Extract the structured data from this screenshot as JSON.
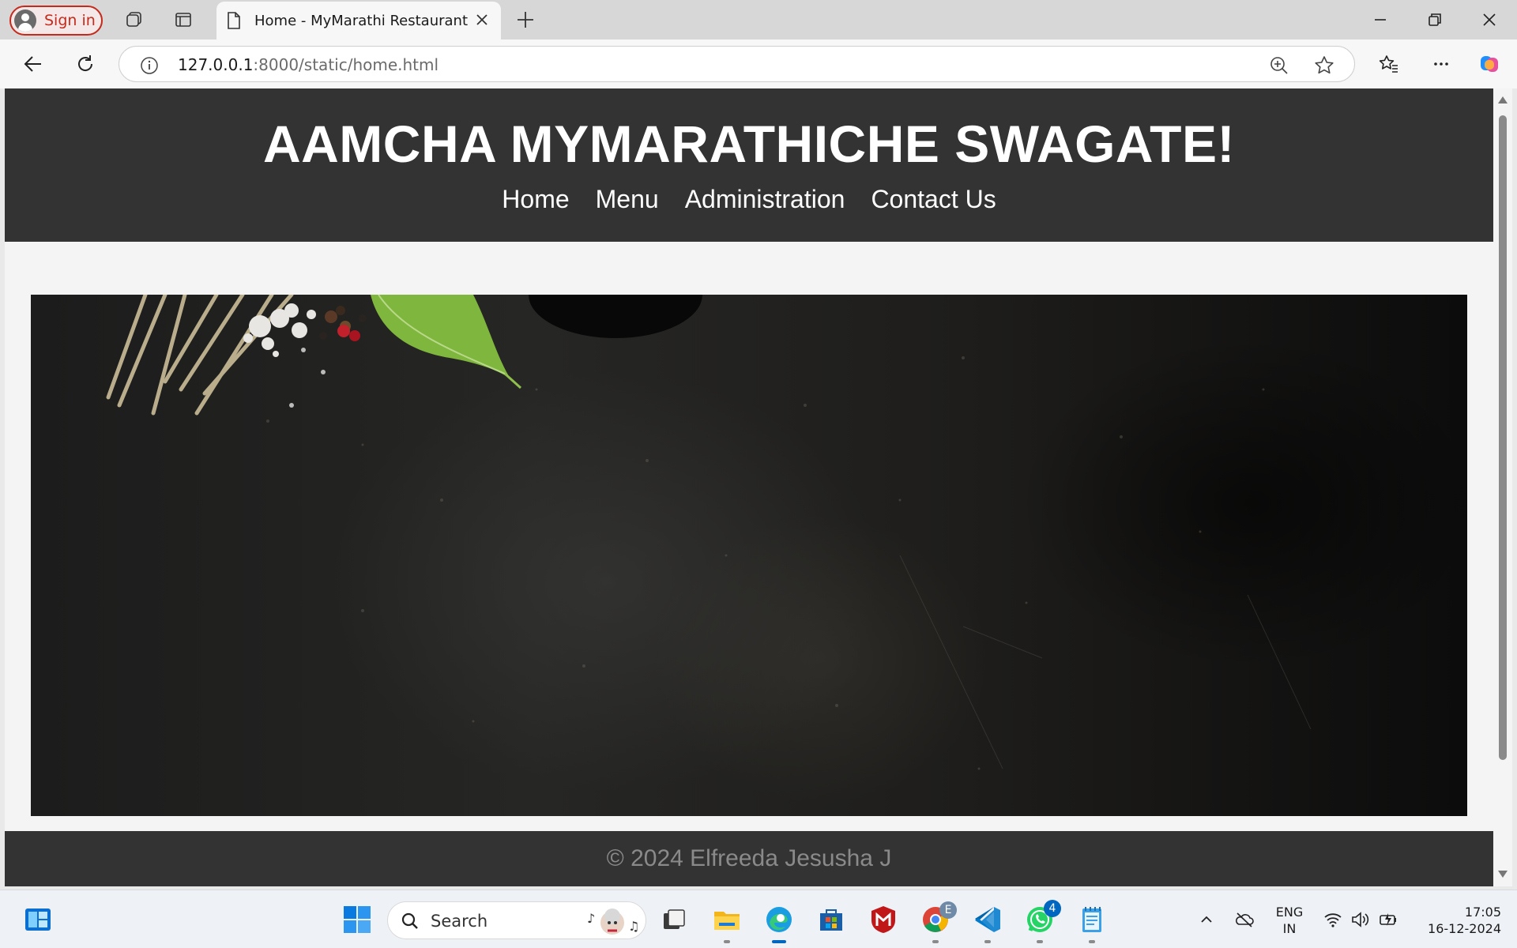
{
  "browser": {
    "signin_label": "Sign in",
    "tab": {
      "title": "Home - MyMarathi Restaurant"
    },
    "address": {
      "host": "127.0.0.1",
      "path": ":8000/static/home.html"
    }
  },
  "page": {
    "title": "AAMCHA MYMARATHICHE SWAGATE!",
    "nav": [
      "Home",
      "Menu",
      "Administration",
      "Contact Us"
    ],
    "footer": "© 2024 Elfreeda Jesusha J"
  },
  "taskbar": {
    "search_label": "Search",
    "chrome_badge": "E",
    "whatsapp_badge": "4",
    "lang_line1": "ENG",
    "lang_line2": "IN",
    "time": "17:05",
    "date": "16-12-2024"
  },
  "colors": {
    "header_bg": "#333333",
    "signin_accent": "#c42b1c",
    "page_bg": "#f4f4f4",
    "accent_blue": "#0067c0"
  }
}
